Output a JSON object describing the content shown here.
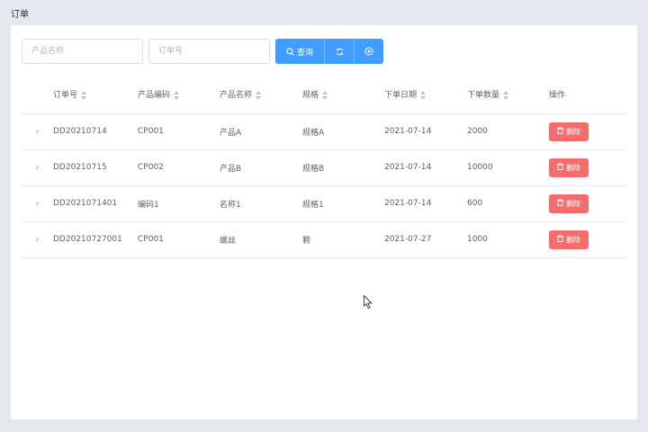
{
  "page": {
    "title": "订单"
  },
  "search": {
    "product_name_placeholder": "产品名称",
    "order_no_placeholder": "订单号",
    "search_label": "查询"
  },
  "table": {
    "columns": [
      "订单号",
      "产品编码",
      "产品名称",
      "规格",
      "下单日期",
      "下单数量",
      "操作"
    ],
    "delete_label": "删除",
    "rows": [
      {
        "order_no": "DD20210714",
        "product_code": "CP001",
        "product_name": "产品A",
        "spec": "规格A",
        "date": "2021-07-14",
        "qty": "2000"
      },
      {
        "order_no": "DD20210715",
        "product_code": "CP002",
        "product_name": "产品B",
        "spec": "规格B",
        "date": "2021-07-14",
        "qty": "10000"
      },
      {
        "order_no": "DD2021071401",
        "product_code": "编码1",
        "product_name": "名称1",
        "spec": "规格1",
        "date": "2021-07-14",
        "qty": "600"
      },
      {
        "order_no": "DD20210727001",
        "product_code": "CP001",
        "product_name": "螺丝",
        "spec": "颗",
        "date": "2021-07-27",
        "qty": "1000"
      }
    ]
  },
  "colors": {
    "primary": "#409eff",
    "danger": "#f56c6c",
    "background": "#e4e9f0"
  }
}
